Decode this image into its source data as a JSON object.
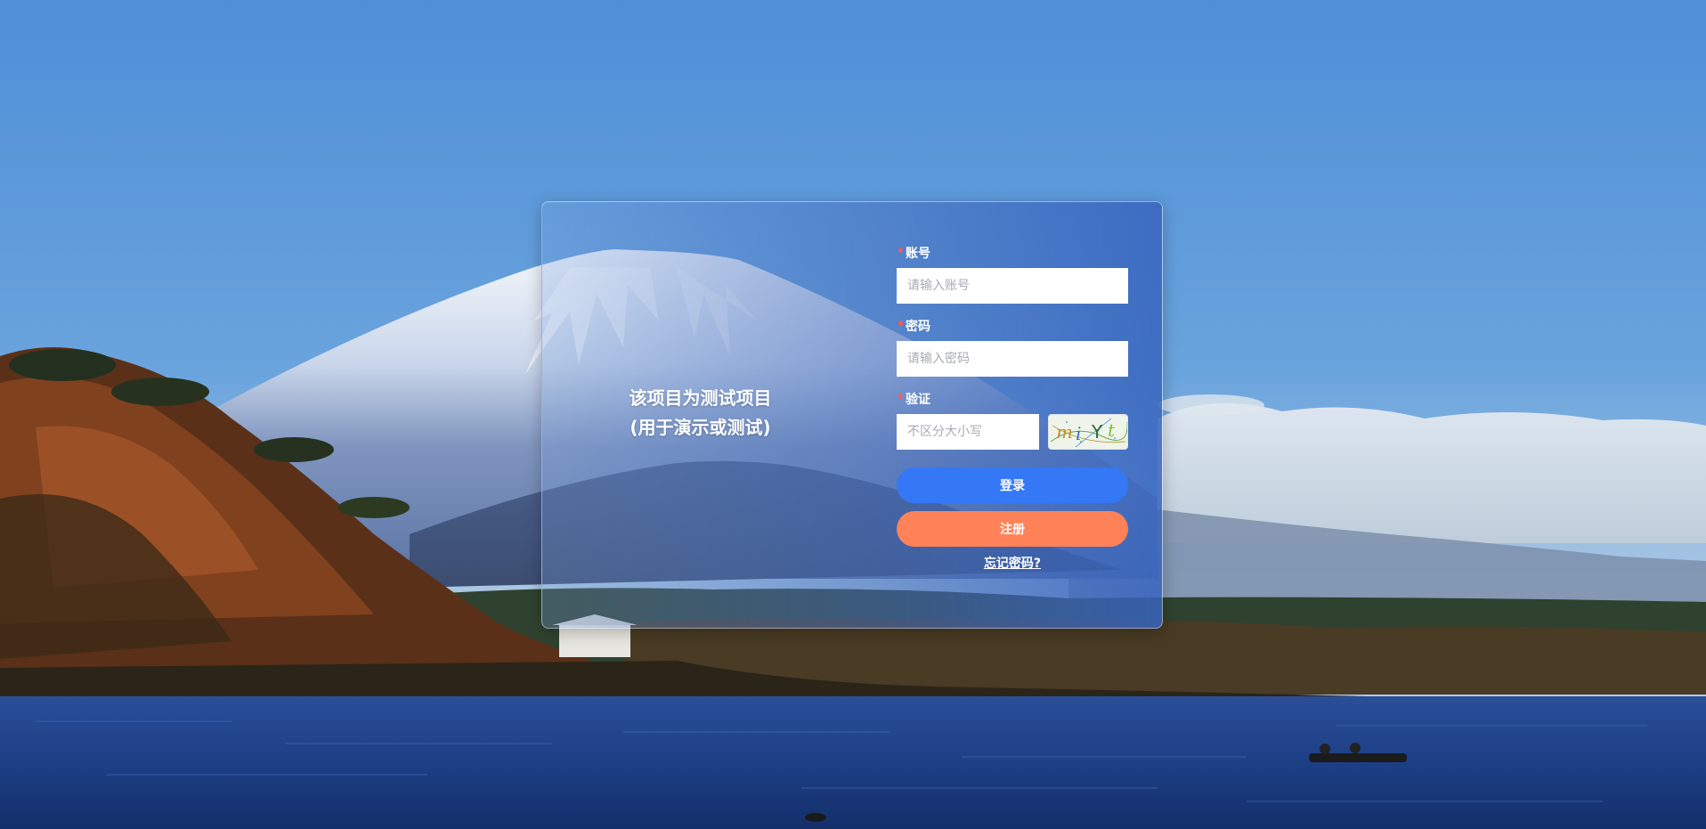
{
  "notice": {
    "line1": "该项目为测试项目",
    "line2": "(用于演示或测试)"
  },
  "form": {
    "account": {
      "label": "账号",
      "required_mark": "*",
      "placeholder": "请输入账号",
      "value": ""
    },
    "password": {
      "label": "密码",
      "required_mark": "*",
      "placeholder": "请输入密码",
      "value": ""
    },
    "captcha": {
      "label": "验证",
      "required_mark": "*",
      "placeholder": "不区分大小写",
      "value": "",
      "image_text": "miYt"
    },
    "login_label": "登录",
    "register_label": "注册",
    "forgot_label": "忘记密码?"
  },
  "colors": {
    "login_button": "#3478f6",
    "register_button": "#ff8258",
    "required_mark": "#ff5a5a",
    "sky_top": "#4a8ad6",
    "lake": "#1d3f86"
  }
}
